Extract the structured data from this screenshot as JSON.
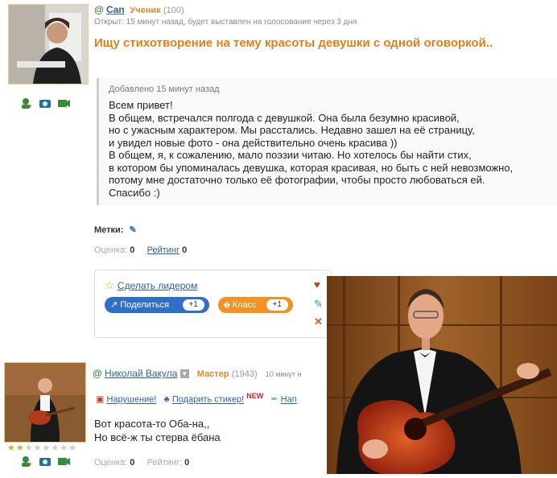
{
  "question": {
    "user": {
      "name": "Can",
      "rank": "Ученик",
      "rank_points": "(100)"
    },
    "meta": "Открыт: 15 минут назад, будет выставлен на голосование через 3 дня",
    "title": "Ищу стихотворение на тему красоты девушки с одной оговоркой..",
    "added": "Добавлено 15 минут назад",
    "body": "Всем привет!\nВ общем, встречался полгода с девушкой. Она была безумно красивой,\nно с ужасным характером. Мы расстались. Недавно зашел на её страницу,\nи увидел новые фото - она действительно очень красива ))\nВ общем, я, к сожалению, мало поэзии читаю. Но хотелось бы найти стих,\nв котором бы упоминалась девушка, которая красивая, но быть с ней невозможно,\nпотому мне достаточно только её фотографии, чтобы просто любоваться ей.\nСпасибо :)",
    "tags_label": "Метки:",
    "stats": {
      "rating_label": "Оценка:",
      "rating_value": "0",
      "rank_label": "Рейтинг",
      "rank_value": "0"
    }
  },
  "share": {
    "make_leader": "Сделать лидером",
    "share_label": "Поделиться",
    "share_count": "+1",
    "class_label": "Класс",
    "class_count": "+1"
  },
  "answer": {
    "user": {
      "name": "Николай Вакула",
      "rank": "Мастер",
      "rank_points": "(1943)",
      "time": "10 минут н"
    },
    "report": "Нарушение!",
    "gift": "Подарить стикер!",
    "new_badge": "NEW",
    "more": "Нап",
    "body": "Вот красота-то Оба-на,,\nНо всё-ж ты стерва ёбана",
    "stats": {
      "rating_label": "Оценка:",
      "rating_value": "0",
      "rank_label": "Рейтинг:",
      "rank_value": "0"
    }
  },
  "icons": {
    "user_add": "user-add-icon",
    "photo": "camera-icon",
    "video": "video-icon",
    "share": "share-icon",
    "star": "star-icon",
    "pencil": "pencil-icon"
  },
  "colors": {
    "title": "#e07f1a",
    "link": "#2b5fa6",
    "share_pill": "#2d6fc9",
    "class_pill": "#f39220"
  }
}
